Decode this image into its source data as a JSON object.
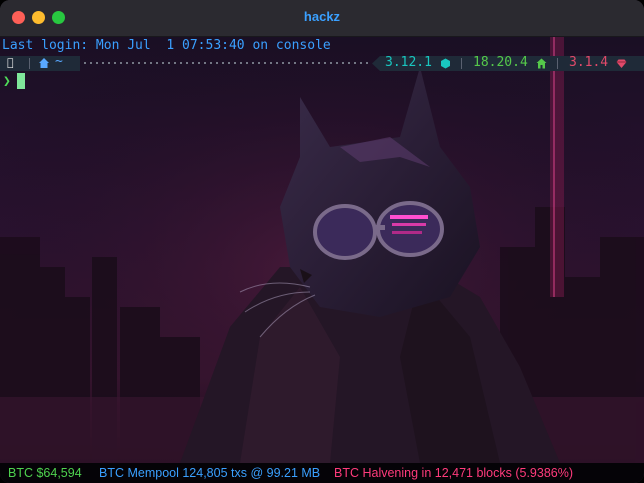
{
  "window": {
    "title": "hackz",
    "accent": "#3aa0ff"
  },
  "terminal": {
    "last_login": "Last login: Mon Jul  1 07:53:40 on console",
    "cwd": "~",
    "prompt_symbol": "❯",
    "versions": [
      {
        "lang": "python",
        "value": "3.12.1",
        "icon": "python-icon",
        "color": "#19c7c0"
      },
      {
        "lang": "node",
        "value": "18.20.4",
        "icon": "node-icon",
        "color": "#55c94a"
      },
      {
        "lang": "ruby",
        "value": "3.1.4",
        "icon": "ruby-icon",
        "color": "#e04a6a"
      }
    ]
  },
  "statusbar": {
    "btc_price": "BTC $64,594",
    "mempool": "BTC Mempool 124,805 txs @ 99.21 MB",
    "halving": "BTC Halvening in 12,471 blocks (5.9386%)"
  }
}
